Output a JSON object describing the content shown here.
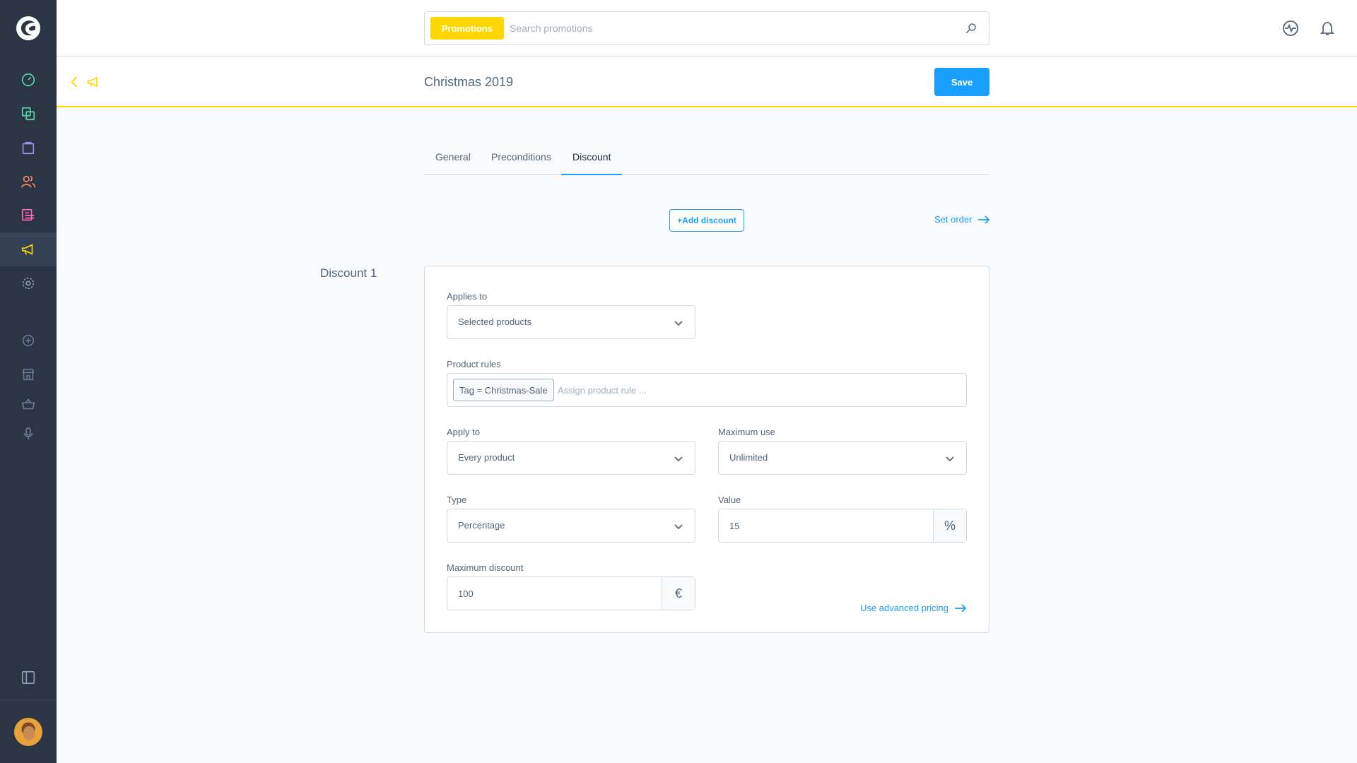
{
  "search": {
    "module_tag": "Promotions",
    "placeholder": "Search promotions"
  },
  "smartbar": {
    "title": "Christmas 2019",
    "save_label": "Save"
  },
  "tabs": [
    {
      "label": "General"
    },
    {
      "label": "Preconditions"
    },
    {
      "label": "Discount",
      "active": true
    }
  ],
  "actions": {
    "add_discount_label": "+Add discount",
    "set_order_label": "Set order"
  },
  "discount": {
    "title": "Discount 1",
    "applies_to": {
      "label": "Applies to",
      "value": "Selected products"
    },
    "product_rules": {
      "label": "Product rules",
      "chip": "Tag = Christmas-Sale",
      "placeholder": "Assign product rule ..."
    },
    "apply_to": {
      "label": "Apply to",
      "value": "Every product"
    },
    "maximum_use": {
      "label": "Maximum use",
      "value": "Unlimited"
    },
    "type": {
      "label": "Type",
      "value": "Percentage"
    },
    "value": {
      "label": "Value",
      "value": "15",
      "suffix": "%"
    },
    "maximum_discount": {
      "label": "Maximum discount",
      "value": "100",
      "suffix": "€"
    },
    "advanced_pricing_label": "Use advanced pricing"
  },
  "colors": {
    "primary": "#189eff",
    "module_accent": "#ffd700",
    "sidebar_bg": "#2b3545"
  },
  "icons": {
    "sidebar": [
      "dashboard-icon",
      "products-icon",
      "orders-icon",
      "customers-icon",
      "content-icon",
      "marketing-icon",
      "settings-icon",
      "plugins-icon",
      "store-icon",
      "basket-icon",
      "microphone-icon",
      "collapse-sidebar-icon"
    ],
    "topbar": [
      "search-icon",
      "activity-icon",
      "bell-icon"
    ]
  }
}
